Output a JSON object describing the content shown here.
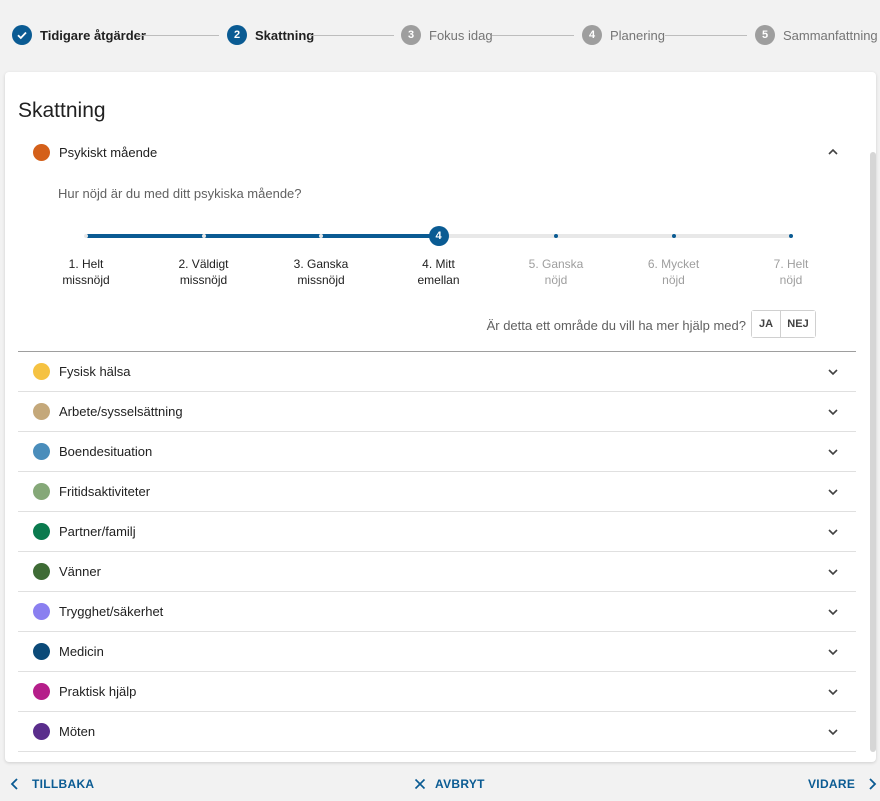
{
  "stepper": {
    "steps": [
      {
        "label": "Tidigare åtgärder",
        "number": "",
        "status": "done"
      },
      {
        "label": "Skattning",
        "number": "2",
        "status": "active"
      },
      {
        "label": "Fokus idag",
        "number": "3",
        "status": "pending"
      },
      {
        "label": "Planering",
        "number": "4",
        "status": "pending"
      },
      {
        "label": "Sammanfattning",
        "number": "5",
        "status": "pending"
      }
    ]
  },
  "card": {
    "title": "Skattning",
    "expanded_section": {
      "label": "Psykiskt mående",
      "color": "#d4601a",
      "question": "Hur nöjd är du med ditt psykiska mående?",
      "rating": {
        "value": 4,
        "thumb_text": "4",
        "options": [
          {
            "line1": "1. Helt",
            "line2": "missnöjd"
          },
          {
            "line1": "2. Väldigt",
            "line2": "missnöjd"
          },
          {
            "line1": "3. Ganska",
            "line2": "missnöjd"
          },
          {
            "line1": "4. Mitt",
            "line2": "emellan"
          },
          {
            "line1": "5. Ganska",
            "line2": "nöjd"
          },
          {
            "line1": "6. Mycket",
            "line2": "nöjd"
          },
          {
            "line1": "7. Helt",
            "line2": "nöjd"
          }
        ]
      },
      "help_question": "Är detta ett område du vill ha mer hjälp med?",
      "yes_label": "JA",
      "no_label": "NEJ"
    },
    "sections": [
      {
        "label": "Fysisk hälsa",
        "color": "#f5c242"
      },
      {
        "label": "Arbete/sysselsättning",
        "color": "#c4a87a"
      },
      {
        "label": "Boendesituation",
        "color": "#4a8dbb"
      },
      {
        "label": "Fritidsaktiviteter",
        "color": "#85a878"
      },
      {
        "label": "Partner/familj",
        "color": "#0a7a4e"
      },
      {
        "label": "Vänner",
        "color": "#3e6b35"
      },
      {
        "label": "Trygghet/säkerhet",
        "color": "#8a7ff0"
      },
      {
        "label": "Medicin",
        "color": "#0b4a78"
      },
      {
        "label": "Praktisk hjälp",
        "color": "#b51e8a"
      },
      {
        "label": "Möten",
        "color": "#5a2d8c"
      }
    ]
  },
  "footer": {
    "back_label": "TILLBAKA",
    "cancel_label": "AVBRYT",
    "next_label": "VIDARE"
  },
  "colors": {
    "primary": "#0a5b93"
  }
}
